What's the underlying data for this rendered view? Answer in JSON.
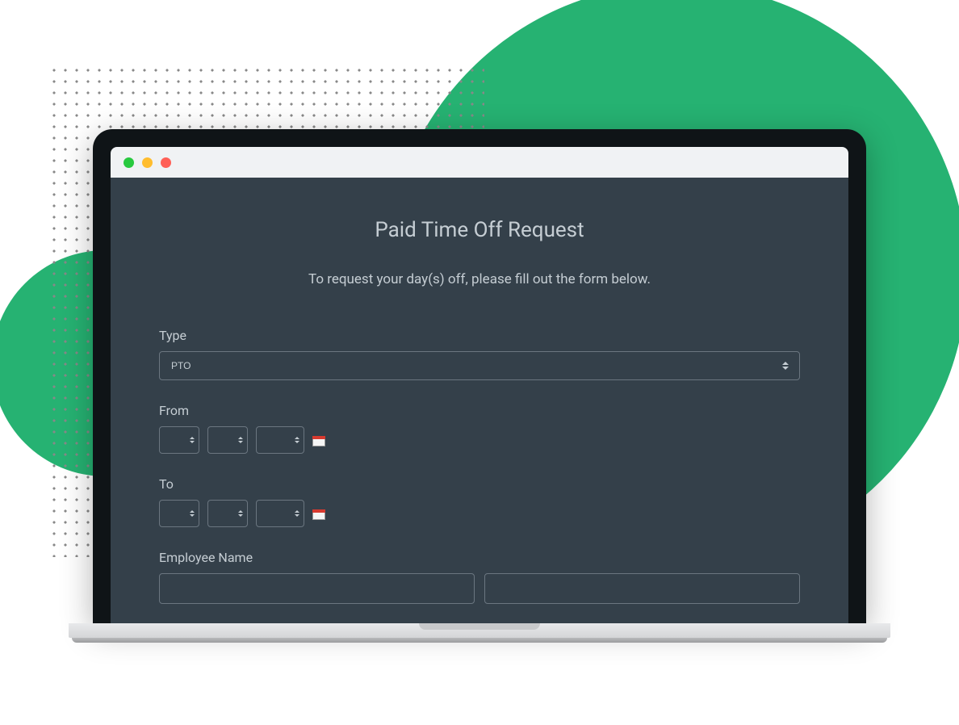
{
  "form": {
    "title": "Paid Time Off Request",
    "description": "To request your day(s) off, please fill out the form below.",
    "fields": {
      "type": {
        "label": "Type",
        "value": "PTO"
      },
      "from": {
        "label": "From"
      },
      "to": {
        "label": "To"
      },
      "employee_name": {
        "label": "Employee Name"
      }
    }
  }
}
